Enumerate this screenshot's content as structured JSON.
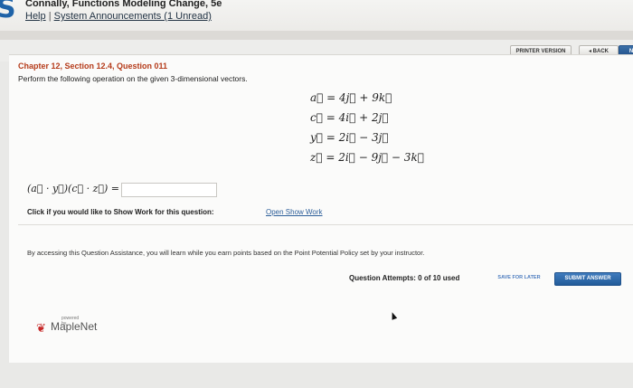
{
  "header": {
    "logo_letter": "S",
    "book_title": "Connally, Functions Modeling Change, 5e",
    "help_label": "Help",
    "separator": "|",
    "announcements_label": "System Announcements (1 Unread)"
  },
  "toolbar": {
    "print_label": "PRINTER VERSION",
    "back_label": "◂ BACK",
    "next_label": "NE"
  },
  "question": {
    "title": "Chapter 12, Section 12.4, Question 011",
    "prompt": "Perform the following operation on the given 3-dimensional vectors.",
    "vectors": [
      "a⃗ = 4j⃗ + 9k⃗",
      "c⃗ = 4i⃗ + 2j⃗",
      "y⃗ = 2i⃗ − 3j⃗",
      "z⃗ = 2i⃗ − 9j⃗ − 3k⃗"
    ],
    "expression": "(a⃗ · y⃗)(c⃗ · z⃗) =",
    "answer_value": ""
  },
  "show_work": {
    "prompt": "Click if you would like to Show Work for this question:",
    "link": "Open Show Work"
  },
  "assistance_text": "By accessing this Question Assistance, you will learn while you earn points based on the Point Potential Policy set by your instructor.",
  "attempts": "Question Attempts: 0 of 10 used",
  "buttons": {
    "save_later": "SAVE FOR LATER",
    "submit": "SUBMIT ANSWER"
  },
  "footer": {
    "powered_by": "powered by",
    "brand": "MapleNet",
    "leaf_icon": "maple-leaf-icon"
  }
}
